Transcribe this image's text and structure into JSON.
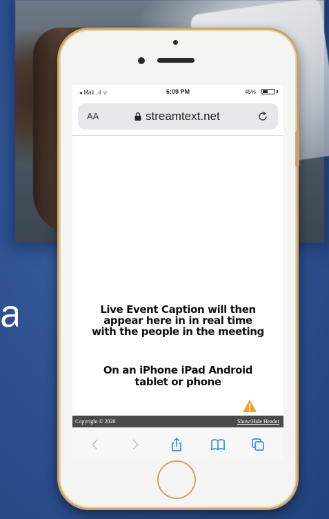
{
  "background": {
    "accent": "#2e5293",
    "side_char": "a"
  },
  "phone": {
    "frame_color": "#c9a46a"
  },
  "status_bar": {
    "carrier": "◂ Mail ..ıl ᯤ",
    "time": "6:09 PM",
    "battery_text": "45%",
    "battery_level": 0.45
  },
  "address_bar": {
    "text_size_label": "AA",
    "url": "streamtext.net"
  },
  "caption": {
    "line1": "Live Event Caption will then",
    "line2": "appear here in in real time",
    "line3": "with the people in the meeting",
    "line4": "On an iPhone iPad Android",
    "line5": "tablet or phone"
  },
  "footer": {
    "copyright": "Copyright © 2020",
    "toggle_header": "Show/Hide Header",
    "color": "#4a4a4a"
  },
  "toolbar": {
    "icons": [
      "back-icon",
      "forward-icon",
      "share-icon",
      "bookmarks-icon",
      "tabs-icon"
    ],
    "icon_color": "#1a7cf5"
  },
  "warning_color": "#f3a01b"
}
